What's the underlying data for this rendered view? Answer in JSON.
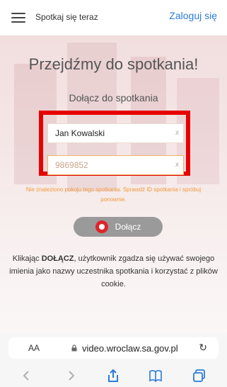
{
  "header": {
    "app_title": "Spotkaj się teraz",
    "login_label": "Zaloguj się"
  },
  "main": {
    "heading": "Przejdźmy do spotkania!",
    "subheading": "Dołącz do spotkania",
    "name_input": {
      "value": "Jan Kowalski",
      "clear_label": "x"
    },
    "room_id_input": {
      "value": "9869852",
      "clear_label": "x"
    },
    "error_message": "Nie znaleziono pokoju tego spotkania. Sprawdź ID spotkania i spróbuj ponownie.",
    "join_button_label": "Dołącz",
    "consent_prefix": "Klikając ",
    "consent_bold": "DOŁĄCZ",
    "consent_suffix": ", użytkownik zgadza się używać swojego imienia jako nazwy uczestnika spotkania i korzystać z plików cookie."
  },
  "browser": {
    "text_size_label": "AA",
    "url": "video.wroclaw.sa.gov.pl",
    "reload_icon": "reload-icon",
    "nav_icons": [
      "back-icon",
      "forward-icon",
      "share-icon",
      "bookmarks-icon",
      "tabs-icon"
    ]
  },
  "colors": {
    "accent": "#2b7cd6",
    "error": "#f29a3a",
    "highlight": "#e60000",
    "join_button": "#9a9a9a"
  }
}
